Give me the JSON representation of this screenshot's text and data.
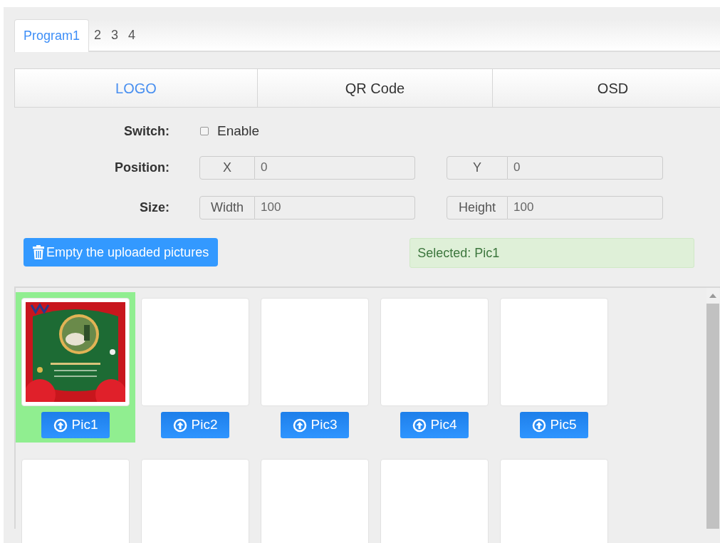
{
  "program_tabs": [
    {
      "label": "Program1",
      "selected": true
    },
    {
      "label": "2",
      "selected": false
    },
    {
      "label": "3",
      "selected": false
    },
    {
      "label": "4",
      "selected": false
    }
  ],
  "sub_tabs": [
    {
      "label": "LOGO",
      "selected": true
    },
    {
      "label": "QR Code",
      "selected": false
    },
    {
      "label": "OSD",
      "selected": false
    }
  ],
  "switch": {
    "label": "Switch:",
    "option": "Enable",
    "checked": false
  },
  "position": {
    "label": "Position:",
    "fields": [
      {
        "addon": "X",
        "value": "0"
      },
      {
        "addon": "Y",
        "value": "0"
      }
    ]
  },
  "size": {
    "label": "Size:",
    "fields": [
      {
        "addon": "Width",
        "value": "100"
      },
      {
        "addon": "Height",
        "value": "100"
      }
    ]
  },
  "empty_button": "Empty the uploaded pictures",
  "selected_alert": "Selected: Pic1",
  "pictures": [
    {
      "kind": "picture",
      "label": "Pic1",
      "selected": true
    },
    {
      "label": "Pic2",
      "selected": false
    },
    {
      "label": "Pic3",
      "selected": false
    },
    {
      "label": "Pic4",
      "selected": false
    },
    {
      "label": "Pic5",
      "selected": false
    },
    {
      "selected": false
    },
    {
      "selected": false
    },
    {
      "selected": false
    },
    {
      "selected": false
    },
    {
      "selected": false
    }
  ]
}
